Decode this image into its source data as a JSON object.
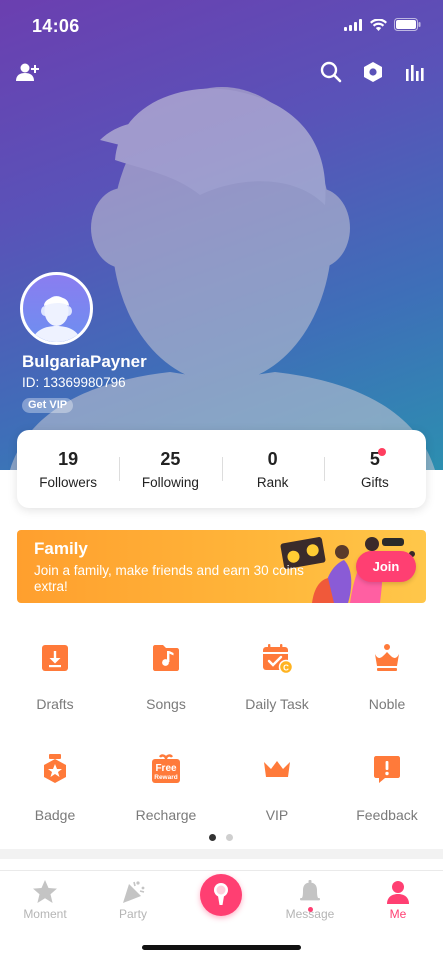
{
  "status_bar": {
    "time": "14:06"
  },
  "profile": {
    "username": "BulgariaPayner",
    "id_text": "ID: 13369980796",
    "vip_label": "Get VIP"
  },
  "stats": [
    {
      "value": "19",
      "label": "Followers"
    },
    {
      "value": "25",
      "label": "Following"
    },
    {
      "value": "0",
      "label": "Rank"
    },
    {
      "value": "5",
      "label": "Gifts",
      "has_dot": true
    }
  ],
  "family_banner": {
    "title": "Family",
    "description": "Join a family, make friends and earn 30 coins extra!",
    "join_label": "Join"
  },
  "features": [
    {
      "label": "Drafts",
      "icon": "drafts-icon"
    },
    {
      "label": "Songs",
      "icon": "songs-icon"
    },
    {
      "label": "Daily Task",
      "icon": "daily-task-icon"
    },
    {
      "label": "Noble",
      "icon": "noble-icon"
    },
    {
      "label": "Badge",
      "icon": "badge-icon"
    },
    {
      "label": "Recharge",
      "icon": "recharge-icon",
      "icon_text": [
        "Free",
        "Reward"
      ]
    },
    {
      "label": "VIP",
      "icon": "vip-crown-icon"
    },
    {
      "label": "Feedback",
      "icon": "feedback-icon"
    }
  ],
  "tabbar": {
    "items": [
      {
        "label": "Moment",
        "icon": "star-icon",
        "active": false
      },
      {
        "label": "Party",
        "icon": "party-icon",
        "active": false
      },
      {
        "label": "Message",
        "icon": "bell-icon",
        "active": false
      },
      {
        "label": "Me",
        "icon": "person-icon",
        "active": true
      }
    ]
  },
  "colors": {
    "accent": "#ff3f72",
    "feature_orange": "#ff7a3a",
    "banner_orange": "#ffb63a"
  }
}
